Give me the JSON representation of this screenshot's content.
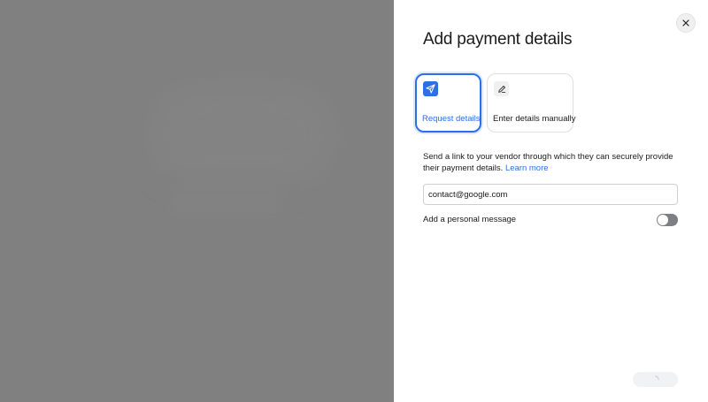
{
  "dialog": {
    "title": "Add payment details",
    "close_icon": "close-icon"
  },
  "options": [
    {
      "label": "Request details",
      "icon": "send-icon",
      "selected": true
    },
    {
      "label": "Enter details manually",
      "icon": "pencil-icon",
      "selected": false
    }
  ],
  "description": {
    "text": "Send a link to your vendor through which they can securely provide their payment details.",
    "link": "Learn more"
  },
  "email_field": {
    "value": "contact@google.com"
  },
  "personal_message": {
    "label": "Add a personal message",
    "enabled": false
  },
  "submit": {
    "state": "loading",
    "icon": "spinner-icon"
  },
  "colors": {
    "accent": "#2d6fe6",
    "overlay": "#808080",
    "toggle_off": "#7e7f82"
  }
}
